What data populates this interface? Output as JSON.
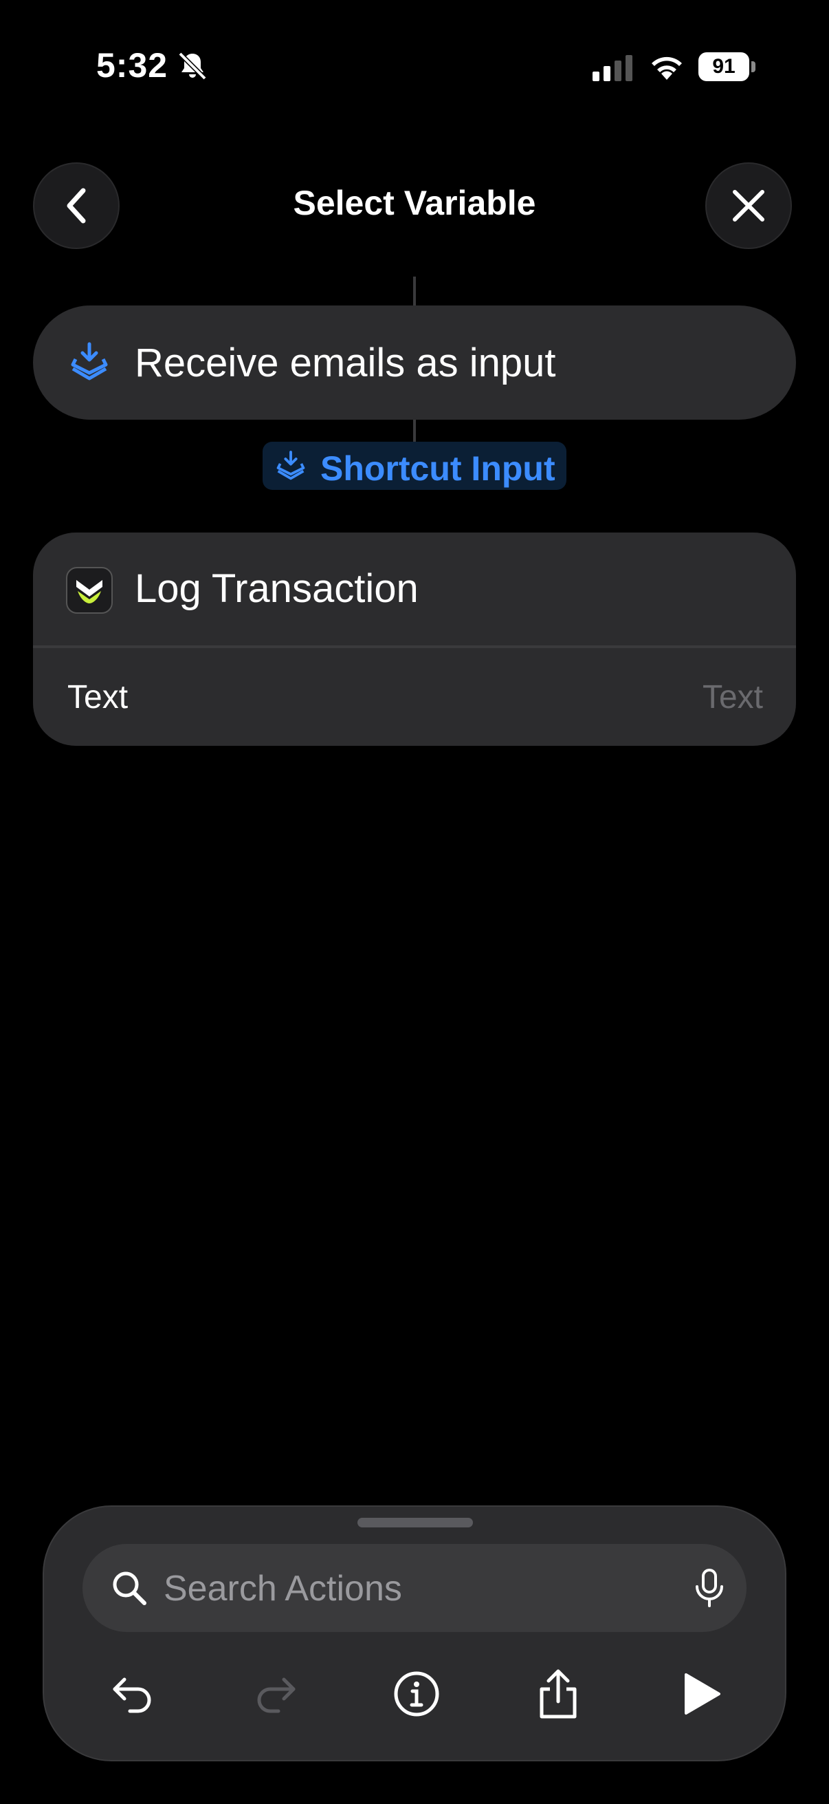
{
  "status_bar": {
    "time": "5:32",
    "battery_percent": "91"
  },
  "header": {
    "title": "Select Variable"
  },
  "actions": {
    "receive": {
      "label": "Receive emails as input"
    },
    "shortcut_input": {
      "label": "Shortcut Input"
    },
    "log_transaction": {
      "title": "Log Transaction",
      "param_label": "Text",
      "param_placeholder": "Text"
    }
  },
  "bottom_sheet": {
    "search_placeholder": "Search Actions"
  },
  "colors": {
    "accent": "#3c8cff",
    "background": "#000000",
    "card": "#2c2c2e"
  }
}
